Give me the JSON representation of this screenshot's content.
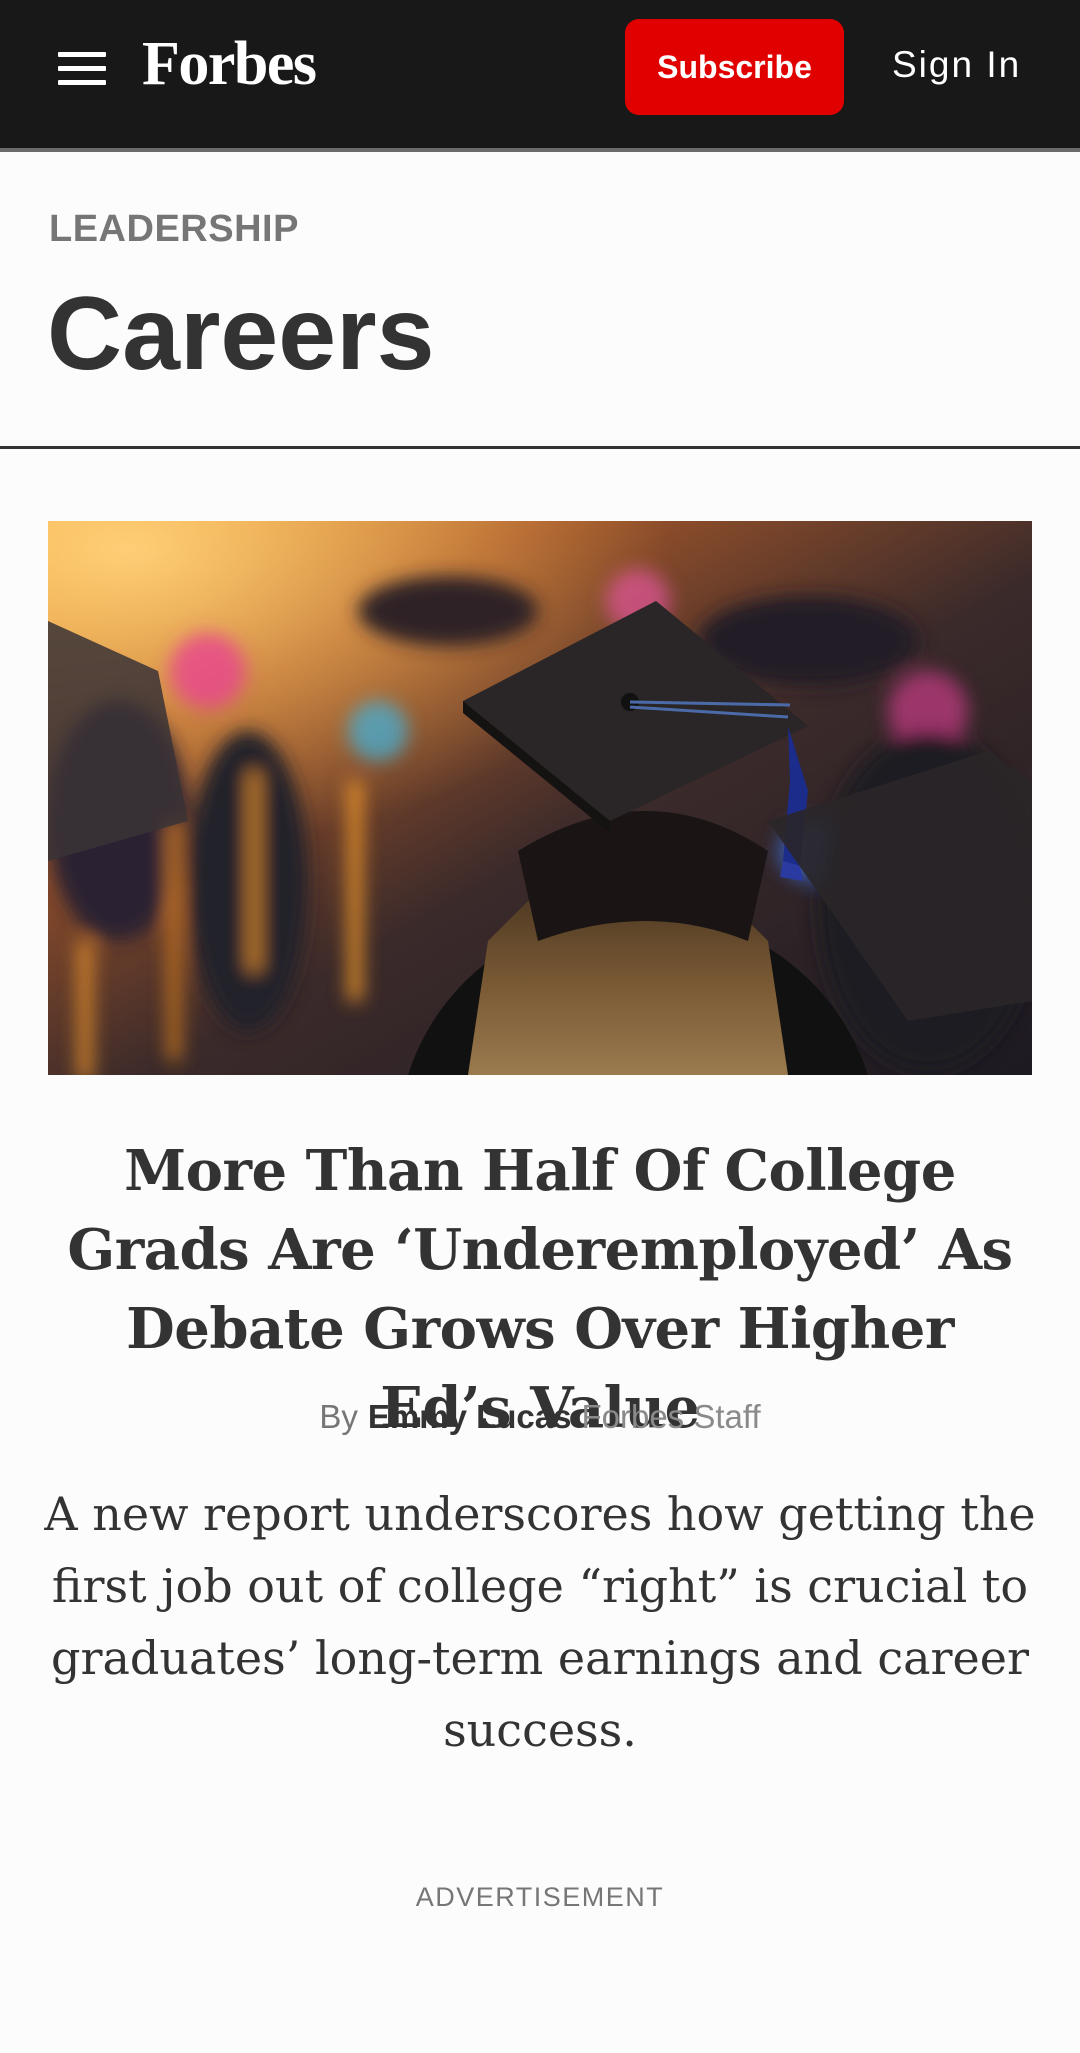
{
  "header": {
    "logo": "Forbes",
    "subscribe_label": "Subscribe",
    "signin_label": "Sign In",
    "colors": {
      "background": "#181818",
      "subscribe": "#e10000"
    }
  },
  "section": {
    "label": "LEADERSHIP",
    "channel": "Careers"
  },
  "article": {
    "headline": "More Than Half Of College Grads Are ‘Underemployed’ As Debate Grows Over Higher Ed’s Value",
    "byline_prefix": "By",
    "author": "Emmy Lucas",
    "author_role": "Forbes Staff",
    "dek": "A new report underscores how getting the first job out of college “right” is crucial to graduates’ long-term earnings and career success."
  },
  "ad": {
    "label": "ADVERTISEMENT"
  },
  "icons": {
    "menu": "hamburger-menu-icon"
  }
}
